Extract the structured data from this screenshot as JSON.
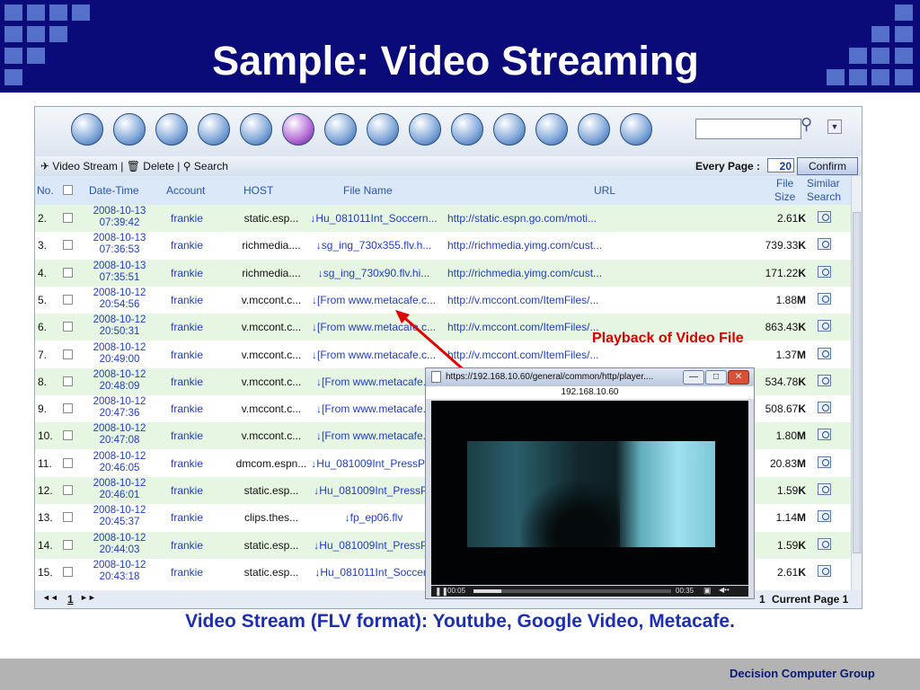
{
  "slide": {
    "title": "Sample: Video Streaming",
    "caption": "Video Stream (FLV format): Youtube, Google Video, Metacafe.",
    "footer": "Decision Computer Group",
    "annotation": "Playback of Video File"
  },
  "toolbar": {
    "video_stream": "Video Stream",
    "delete": "Delete",
    "search": "Search",
    "every_page_label": "Every Page :",
    "every_page_value": "20",
    "confirm": "Confirm",
    "search_placeholder": ""
  },
  "icons": [
    "devices-icon",
    "mail-icon",
    "chat-icon",
    "calendar-icon",
    "gift-icon",
    "browser-icon",
    "terminal-icon",
    "settings-icon",
    "refresh-icon",
    "tools-icon",
    "notes-icon",
    "folder-search-icon",
    "mail-send-icon",
    "chart-icon"
  ],
  "columns": {
    "no": "No.",
    "date_time": "Date-Time",
    "account": "Account",
    "host": "HOST",
    "file_name": "File Name",
    "url": "URL",
    "file_size_1": "File",
    "file_size_2": "Size",
    "similar_1": "Similar",
    "similar_2": "Search"
  },
  "rows": [
    {
      "no": "2.",
      "date": "2008-10-13",
      "time": "07:39:42",
      "account": "frankie",
      "host": "static.esp...",
      "file": "↓Hu_081011Int_Soccern...",
      "url": "http://static.espn.go.com/moti...",
      "size": "2.61",
      "unit": "K"
    },
    {
      "no": "3.",
      "date": "2008-10-13",
      "time": "07:36:53",
      "account": "frankie",
      "host": "richmedia....",
      "file": "↓sg_ing_730x355.flv.h...",
      "url": "http://richmedia.yimg.com/cust...",
      "size": "739.33",
      "unit": "K"
    },
    {
      "no": "4.",
      "date": "2008-10-13",
      "time": "07:35:51",
      "account": "frankie",
      "host": "richmedia....",
      "file": "↓sg_ing_730x90.flv.hi...",
      "url": "http://richmedia.yimg.com/cust...",
      "size": "171.22",
      "unit": "K"
    },
    {
      "no": "5.",
      "date": "2008-10-12",
      "time": "20:54:56",
      "account": "frankie",
      "host": "v.mccont.c...",
      "file": "↓[From www.metacafe.c...",
      "url": "http://v.mccont.com/ItemFiles/...",
      "size": "1.88",
      "unit": "M"
    },
    {
      "no": "6.",
      "date": "2008-10-12",
      "time": "20:50:31",
      "account": "frankie",
      "host": "v.mccont.c...",
      "file": "↓[From www.metacafe.c...",
      "url": "http://v.mccont.com/ItemFiles/...",
      "size": "863.43",
      "unit": "K"
    },
    {
      "no": "7.",
      "date": "2008-10-12",
      "time": "20:49:00",
      "account": "frankie",
      "host": "v.mccont.c...",
      "file": "↓[From www.metacafe.c...",
      "url": "http://v.mccont.com/ItemFiles/...",
      "size": "1.37",
      "unit": "M"
    },
    {
      "no": "8.",
      "date": "2008-10-12",
      "time": "20:48:09",
      "account": "frankie",
      "host": "v.mccont.c...",
      "file": "↓[From www.metacafe.c",
      "url": "",
      "size": "534.78",
      "unit": "K"
    },
    {
      "no": "9.",
      "date": "2008-10-12",
      "time": "20:47:36",
      "account": "frankie",
      "host": "v.mccont.c...",
      "file": "↓[From www.metacafe.c",
      "url": "",
      "size": "508.67",
      "unit": "K"
    },
    {
      "no": "10.",
      "date": "2008-10-12",
      "time": "20:47:08",
      "account": "frankie",
      "host": "v.mccont.c...",
      "file": "↓[From www.metacafe.c",
      "url": "",
      "size": "1.80",
      "unit": "M"
    },
    {
      "no": "11.",
      "date": "2008-10-12",
      "time": "20:46:05",
      "account": "frankie",
      "host": "dmcom.espn...",
      "file": "↓Hu_081009Int_PressPas",
      "url": "",
      "size": "20.83",
      "unit": "M"
    },
    {
      "no": "12.",
      "date": "2008-10-12",
      "time": "20:46:01",
      "account": "frankie",
      "host": "static.esp...",
      "file": "↓Hu_081009Int_PressPa",
      "url": "",
      "size": "1.59",
      "unit": "K"
    },
    {
      "no": "13.",
      "date": "2008-10-12",
      "time": "20:45:37",
      "account": "frankie",
      "host": "clips.thes...",
      "file": "↓fp_ep06.flv",
      "url": "",
      "size": "1.14",
      "unit": "M"
    },
    {
      "no": "14.",
      "date": "2008-10-12",
      "time": "20:44:03",
      "account": "frankie",
      "host": "static.esp...",
      "file": "↓Hu_081009Int_PressPa",
      "url": "",
      "size": "1.59",
      "unit": "K"
    },
    {
      "no": "15.",
      "date": "2008-10-12",
      "time": "20:43:18",
      "account": "frankie",
      "host": "static.esp...",
      "file": "↓Hu_081011Int_Soccern",
      "url": "",
      "size": "2.61",
      "unit": "K"
    }
  ],
  "pager": {
    "nav_first": "◄◄",
    "page": "1",
    "nav_last": "►►",
    "total": "1",
    "current_label": "Current Page 1"
  },
  "player": {
    "title": "https://192.168.10.60/general/common/http/player....",
    "ip": "192.168.10.60",
    "time_elapsed": "00:05",
    "time_total": "00:35",
    "progress": 0.14
  },
  "colors": {
    "header_bg": "#0a0a78",
    "accent_square": "#5570c8",
    "row_green": "#e7f5e3",
    "link_blue": "#1f3ec2",
    "annotation_red": "#d40000"
  }
}
